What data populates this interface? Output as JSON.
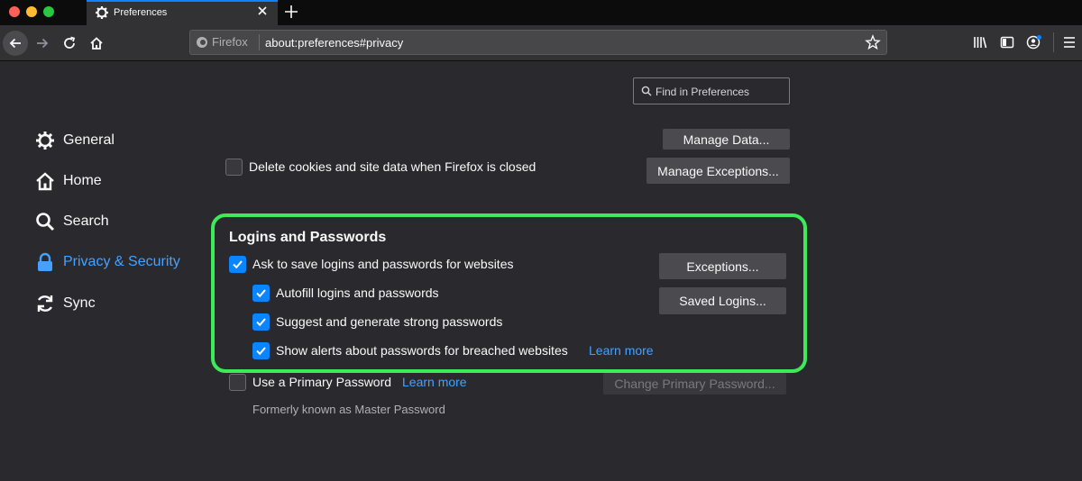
{
  "tab": {
    "title": "Preferences"
  },
  "urlbar": {
    "identity": "Firefox",
    "url": "about:preferences#privacy"
  },
  "search": {
    "placeholder": "Find in Preferences"
  },
  "sidebar": {
    "items": [
      {
        "label": "General",
        "icon": "gear-icon"
      },
      {
        "label": "Home",
        "icon": "home-icon"
      },
      {
        "label": "Search",
        "icon": "search-icon"
      },
      {
        "label": "Privacy & Security",
        "icon": "lock-icon",
        "active": true
      },
      {
        "label": "Sync",
        "icon": "sync-icon"
      }
    ]
  },
  "cookies": {
    "manage_data": "Manage Data...",
    "manage_exceptions": "Manage Exceptions...",
    "delete_on_close": "Delete cookies and site data when Firefox is closed"
  },
  "logins": {
    "title": "Logins and Passwords",
    "ask_to_save": "Ask to save logins and passwords for websites",
    "autofill": "Autofill logins and passwords",
    "suggest": "Suggest and generate strong passwords",
    "alerts": "Show alerts about passwords for breached websites",
    "learn_more": "Learn more",
    "exceptions": "Exceptions...",
    "saved_logins": "Saved Logins...",
    "primary_password": "Use a Primary Password",
    "primary_learn_more": "Learn more",
    "change_primary": "Change Primary Password...",
    "formerly": "Formerly known as Master Password"
  },
  "colors": {
    "accent": "#0a84ff",
    "link": "#45a1ff",
    "highlight": "#3dea5a"
  }
}
